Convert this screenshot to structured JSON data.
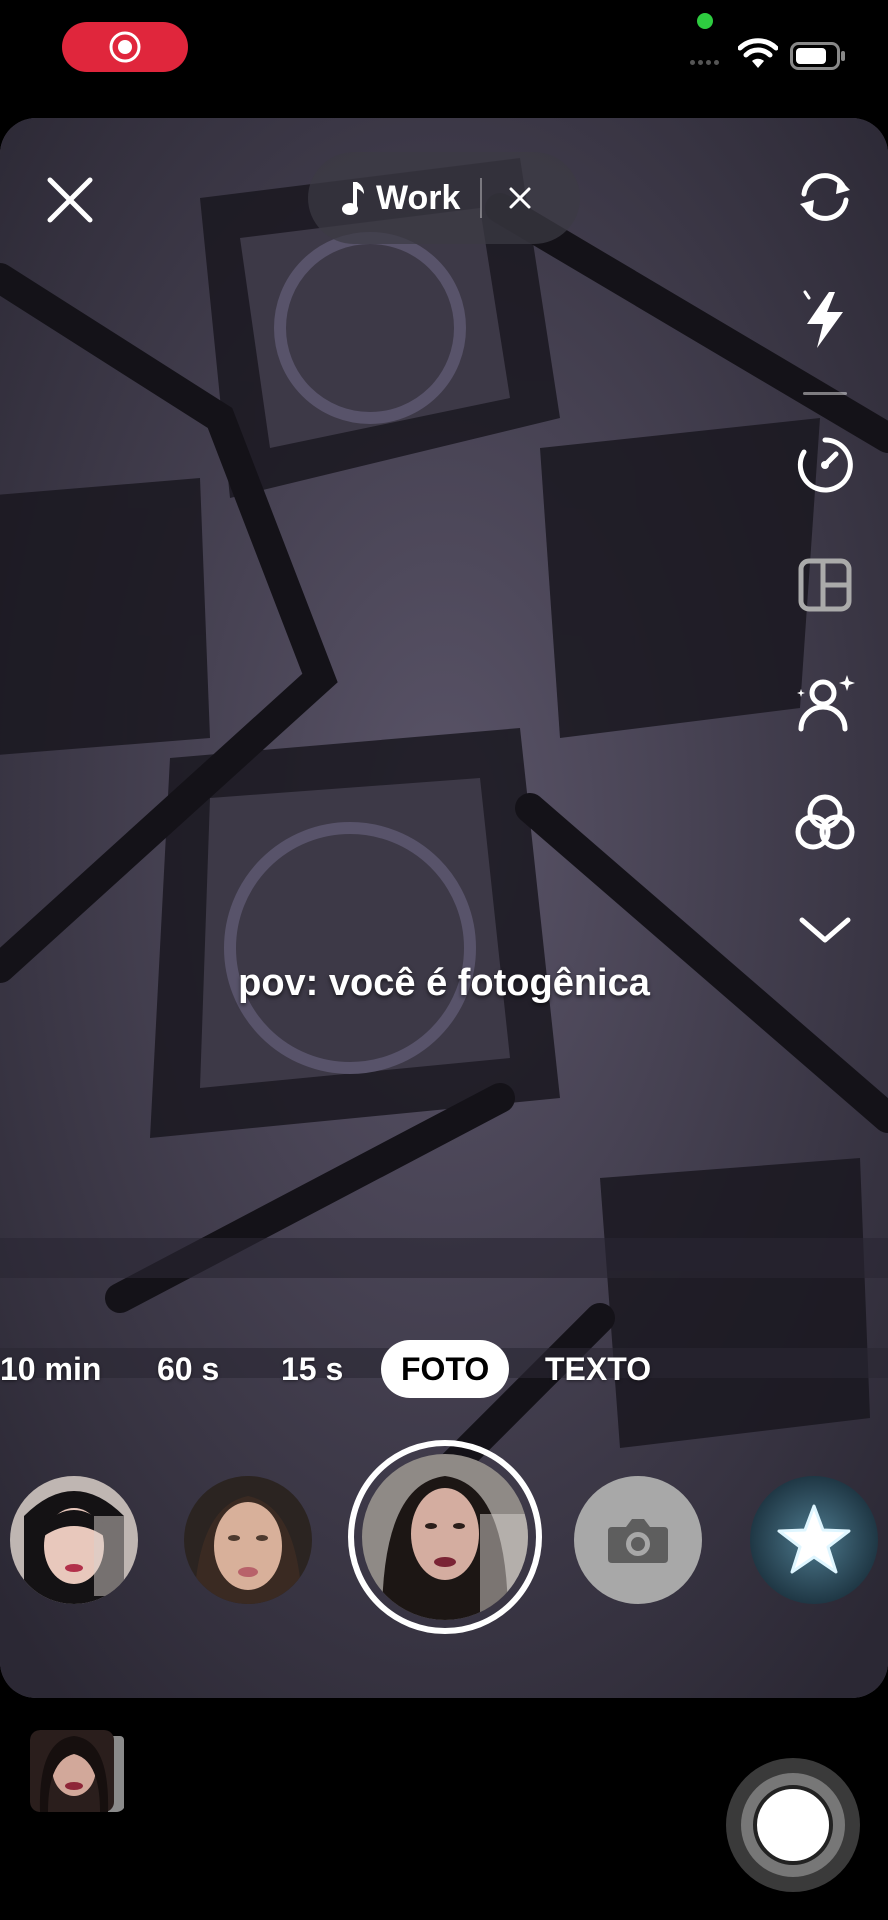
{
  "status_bar": {
    "recording_indicator_icon": "screen-record-icon",
    "camera_in_use_dot_color": "#2ecc40",
    "wifi_icon": "wifi-icon",
    "battery_icon": "battery-icon"
  },
  "top_bar": {
    "close_icon": "close-icon",
    "music": {
      "icon": "music-note-icon",
      "label": "Work",
      "remove_icon": "close-small-icon"
    }
  },
  "side_tools": [
    {
      "name": "flip-camera",
      "icon": "flip-camera-icon"
    },
    {
      "name": "flash",
      "icon": "flash-icon"
    },
    {
      "name": "timer",
      "icon": "timer-icon"
    },
    {
      "name": "layout",
      "icon": "layout-icon"
    },
    {
      "name": "retouch",
      "icon": "retouch-icon"
    },
    {
      "name": "filters",
      "icon": "filters-icon"
    },
    {
      "name": "more",
      "icon": "chevron-down-icon"
    }
  ],
  "caption": "pov: você é fotogênica",
  "modes": [
    {
      "label": "10 min",
      "active": false
    },
    {
      "label": "60 s",
      "active": false
    },
    {
      "label": "15 s",
      "active": false
    },
    {
      "label": "FOTO",
      "active": true
    },
    {
      "label": "TEXTO",
      "active": false
    }
  ],
  "effects_carousel": {
    "items": [
      "effect-portrait-1",
      "effect-portrait-2",
      "effect-portrait-selected",
      "camera-icon",
      "star-effect-icon"
    ]
  },
  "bottom_bar": {
    "gallery_icon": "gallery-thumbnail",
    "capture_icon": "capture-button"
  },
  "colors": {
    "record_pill": "#e0263c",
    "active_mode_bg": "#ffffff"
  }
}
